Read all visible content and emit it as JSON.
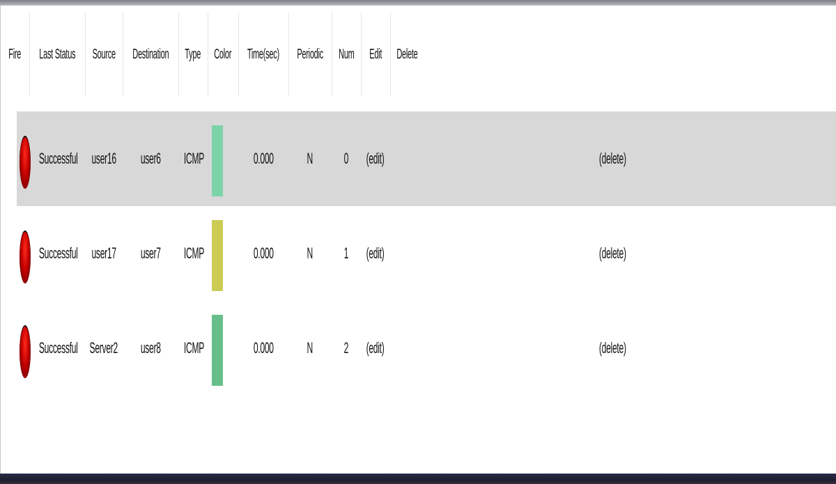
{
  "header": {
    "fire": "Fire",
    "last_status": "Last Status",
    "source": "Source",
    "destination": "Destination",
    "type": "Type",
    "color": "Color",
    "time": "Time(sec)",
    "periodic": "Periodic",
    "num": "Num",
    "edit": "Edit",
    "delete": "Delete"
  },
  "rows": [
    {
      "status": "Successful",
      "source": "user16",
      "destination": "user6",
      "type": "ICMP",
      "color": "#7dd3a8",
      "time": "0.000",
      "periodic": "N",
      "num": "0",
      "edit": "(edit)",
      "delete": "(delete)",
      "selected": true
    },
    {
      "status": "Successful",
      "source": "user17",
      "destination": "user7",
      "type": "ICMP",
      "color": "#cccc55",
      "time": "0.000",
      "periodic": "N",
      "num": "1",
      "edit": "(edit)",
      "delete": "(delete)",
      "selected": false
    },
    {
      "status": "Successful",
      "source": "Server2",
      "destination": "user8",
      "type": "ICMP",
      "color": "#66bf8a",
      "time": "0.000",
      "periodic": "N",
      "num": "2",
      "edit": "(edit)",
      "delete": "(delete)",
      "selected": false
    }
  ],
  "colors": {
    "selected_row": "#d8d8d8",
    "fire_indicator": "#cc0000"
  },
  "icons": {
    "fire": "red-sphere-icon"
  }
}
